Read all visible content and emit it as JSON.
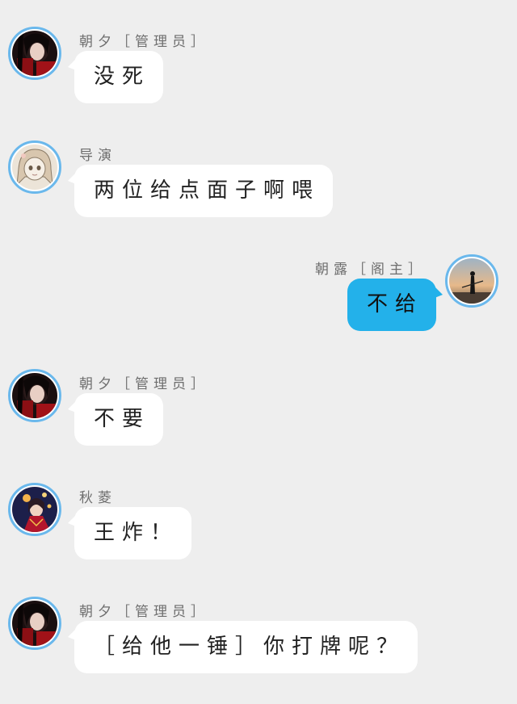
{
  "messages": [
    {
      "side": "left",
      "name": "朝夕［管理员］",
      "text": "没死",
      "avatar": "dark-haired-character-avatar"
    },
    {
      "side": "left",
      "name": "导演",
      "text": "两位给点面子啊喂",
      "avatar": "sketch-girl-avatar"
    },
    {
      "side": "right",
      "name": "朝露［阁主］",
      "text": "不给",
      "avatar": "sunset-swordsman-avatar"
    },
    {
      "side": "left",
      "name": "朝夕［管理员］",
      "text": "不要",
      "avatar": "dark-haired-character-avatar"
    },
    {
      "side": "left",
      "name": "秋菱",
      "text": "王炸！",
      "avatar": "lantern-night-avatar"
    },
    {
      "side": "left",
      "name": "朝夕［管理员］",
      "text": "［给他一锤］你打牌呢？",
      "avatar": "dark-haired-character-avatar"
    }
  ],
  "colors": {
    "background": "#eeeeee",
    "left_bubble": "#ffffff",
    "right_bubble": "#23b1ea",
    "avatar_ring": "#6ab8ec"
  }
}
